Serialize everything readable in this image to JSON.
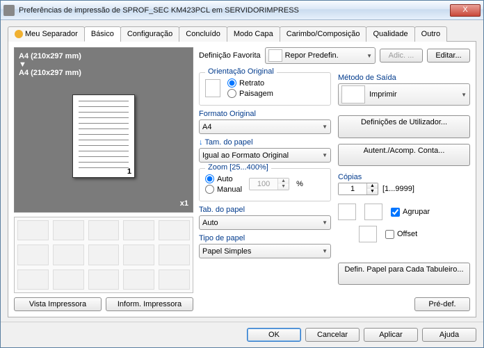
{
  "window": {
    "title": "Preferências de impressão de SPROF_SEC KM423PCL em SERVIDORIMPRESS",
    "close": "X"
  },
  "tabs": {
    "items": [
      "Meu Separador",
      "Básico",
      "Configuração",
      "Concluído",
      "Modo Capa",
      "Carimbo/Composição",
      "Qualidade",
      "Outro"
    ],
    "active": 1
  },
  "preview": {
    "line1": "A4 (210x297 mm)",
    "line2": "A4 (210x297 mm)",
    "page_num": "1",
    "corner": "x1"
  },
  "left_buttons": {
    "view": "Vista Impressora",
    "info": "Inform. Impressora"
  },
  "fav": {
    "label": "Definição Favorita",
    "value": "Repor Predefin.",
    "add": "Adic. ...",
    "edit": "Editar..."
  },
  "orient": {
    "title": "Orientação Original",
    "portrait": "Retrato",
    "landscape": "Paisagem"
  },
  "orig_size": {
    "label": "Formato Original",
    "value": "A4"
  },
  "paper_size": {
    "label": "Tam. do papel",
    "value": "Igual ao Formato Original"
  },
  "zoom": {
    "title": "Zoom [25...400%]",
    "auto": "Auto",
    "manual": "Manual",
    "value": "100",
    "pct": "%"
  },
  "tray": {
    "label": "Tab. do papel",
    "value": "Auto"
  },
  "ptype": {
    "label": "Tipo de papel",
    "value": "Papel Simples"
  },
  "output": {
    "label": "Método de Saída",
    "value": "Imprimir"
  },
  "user_def": "Definições de Utilizador...",
  "auth": "Autent./Acomp. Conta...",
  "copies": {
    "label": "Cópias",
    "value": "1",
    "range": "[1...9999]"
  },
  "collate": "Agrupar",
  "offset": "Offset",
  "per_tray": "Defin. Papel para Cada Tabuleiro...",
  "predef": "Pré-def.",
  "footer": {
    "ok": "OK",
    "cancel": "Cancelar",
    "apply": "Aplicar",
    "help": "Ajuda"
  }
}
